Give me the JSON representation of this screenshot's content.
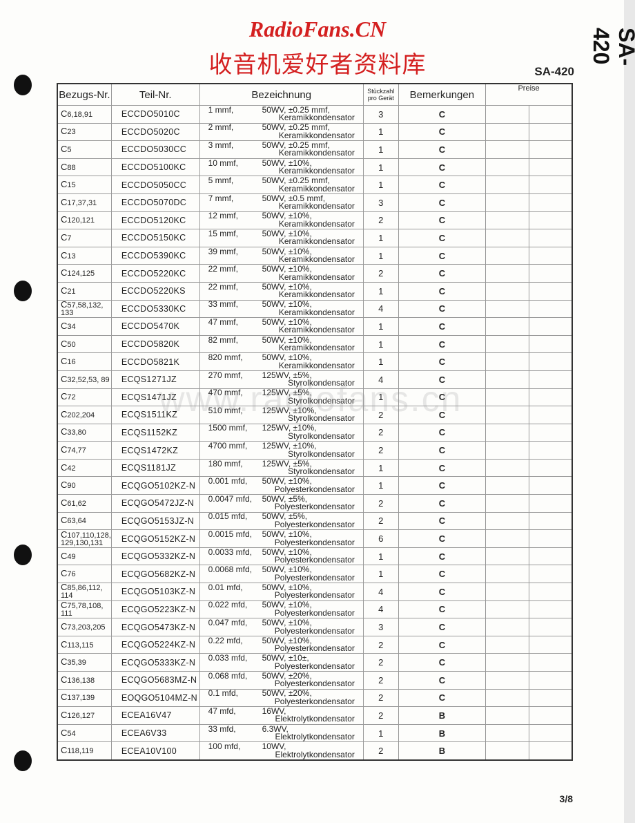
{
  "watermark": {
    "site": "RadioFans.CN",
    "chinese": "收音机爱好者资料库",
    "url": "www.radiofans.cn"
  },
  "model": "SA-420",
  "side_label": "SA-420",
  "page_number": "3/8",
  "headers": {
    "ref": "Bezugs-Nr.",
    "part": "Teil-Nr.",
    "desc": "Bezeichnung",
    "qty_line1": "Stückzahl",
    "qty_line2": "pro Gerät",
    "remarks": "Bemerkungen",
    "prices": "Preise"
  },
  "rows": [
    {
      "ref": "C",
      "sub": "6,18,91",
      "part": "ECCDO5010C",
      "value": "1 mmf,",
      "spec": "50WV, ±0.25 mmf,",
      "type": "Keramikkondensator",
      "qty": "3",
      "remark": "C"
    },
    {
      "ref": "C",
      "sub": "23",
      "part": "ECCDO5020C",
      "value": "2 mmf,",
      "spec": "50WV, ±0.25 mmf,",
      "type": "Keramikkondensator",
      "qty": "1",
      "remark": "C"
    },
    {
      "ref": "C",
      "sub": "5",
      "part": "ECCDO5030CC",
      "value": "3 mmf,",
      "spec": "50WV, ±0.25 mmf,",
      "type": "Keramikkondensator",
      "qty": "1",
      "remark": "C"
    },
    {
      "ref": "C",
      "sub": "88",
      "part": "ECCDO5100KC",
      "value": "10 mmf,",
      "spec": "50WV, ±10%,",
      "type": "Keramikkondensator",
      "qty": "1",
      "remark": "C"
    },
    {
      "ref": "C",
      "sub": "15",
      "part": "ECCDO5050CC",
      "value": "5 mmf,",
      "spec": "50WV, ±0.25 mmf,",
      "type": "Keramikkondensator",
      "qty": "1",
      "remark": "C"
    },
    {
      "ref": "C",
      "sub": "17,37,31",
      "part": "ECCDO5070DC",
      "value": "7 mmf,",
      "spec": "50WV, ±0.5 mmf,",
      "type": "Keramikkondensator",
      "qty": "3",
      "remark": "C"
    },
    {
      "ref": "C",
      "sub": "120,121",
      "part": "ECCDO5120KC",
      "value": "12 mmf,",
      "spec": "50WV, ±10%,",
      "type": "Keramikkondensator",
      "qty": "2",
      "remark": "C"
    },
    {
      "ref": "C",
      "sub": "7",
      "part": "ECCDO5150KC",
      "value": "15 mmf,",
      "spec": "50WV, ±10%,",
      "type": "Keramikkondensator",
      "qty": "1",
      "remark": "C"
    },
    {
      "ref": "C",
      "sub": "13",
      "part": "ECCDO5390KC",
      "value": "39 mmf,",
      "spec": "50WV, ±10%,",
      "type": "Keramikkondensator",
      "qty": "1",
      "remark": "C"
    },
    {
      "ref": "C",
      "sub": "124,125",
      "part": "ECCDO5220KC",
      "value": "22 mmf,",
      "spec": "50WV, ±10%,",
      "type": "Keramikkondensator",
      "qty": "2",
      "remark": "C"
    },
    {
      "ref": "C",
      "sub": "21",
      "part": "ECCDO5220KS",
      "value": "22 mmf,",
      "spec": "50WV, ±10%,",
      "type": "Keramikkondensator",
      "qty": "1",
      "remark": "C"
    },
    {
      "ref": "C",
      "sub": "57,58,132, 133",
      "part": "ECCDO5330KC",
      "value": "33 mmf,",
      "spec": "50WV, ±10%,",
      "type": "Keramikkondensator",
      "qty": "4",
      "remark": "C"
    },
    {
      "ref": "C",
      "sub": "34",
      "part": "ECCDO5470K",
      "value": "47 mmf,",
      "spec": "50WV, ±10%,",
      "type": "Keramikkondensator",
      "qty": "1",
      "remark": "C"
    },
    {
      "ref": "C",
      "sub": "50",
      "part": "ECCDO5820K",
      "value": "82 mmf,",
      "spec": "50WV, ±10%,",
      "type": "Keramikkondensator",
      "qty": "1",
      "remark": "C"
    },
    {
      "ref": "C",
      "sub": "16",
      "part": "ECCDO5821K",
      "value": "820 mmf,",
      "spec": "50WV, ±10%,",
      "type": "Keramikkondensator",
      "qty": "1",
      "remark": "C"
    },
    {
      "ref": "C",
      "sub": "32,52,53, 89",
      "part": "ECQS1271JZ",
      "value": "270 mmf,",
      "spec": "125WV, ±5%,",
      "type": "Styrolkondensator",
      "qty": "4",
      "remark": "C"
    },
    {
      "ref": "C",
      "sub": "72",
      "part": "ECQS1471JZ",
      "value": "470 mmf,",
      "spec": "125WV, ±5%,",
      "type": "Styrolkondensator",
      "qty": "1",
      "remark": "C"
    },
    {
      "ref": "C",
      "sub": "202,204",
      "part": "ECQS1511KZ",
      "value": "510 mmf,",
      "spec": "125WV, ±10%,",
      "type": "Styrolkondensator",
      "qty": "2",
      "remark": "C"
    },
    {
      "ref": "C",
      "sub": "33,80",
      "part": "ECQS1152KZ",
      "value": "1500 mmf,",
      "spec": "125WV, ±10%,",
      "type": "Styrolkondensator",
      "qty": "2",
      "remark": "C"
    },
    {
      "ref": "C",
      "sub": "74,77",
      "part": "ECQS1472KZ",
      "value": "4700 mmf,",
      "spec": "125WV, ±10%,",
      "type": "Styrolkondensator",
      "qty": "2",
      "remark": "C"
    },
    {
      "ref": "C",
      "sub": "42",
      "part": "ECQS1181JZ",
      "value": "180 mmf,",
      "spec": "125WV, ±5%,",
      "type": "Styrolkondensator",
      "qty": "1",
      "remark": "C"
    },
    {
      "ref": "C",
      "sub": "90",
      "part": "ECQGO5102KZ-N",
      "value": "0.001 mfd,",
      "spec": "50WV, ±10%,",
      "type": "Polyesterkondensator",
      "qty": "1",
      "remark": "C"
    },
    {
      "ref": "C",
      "sub": "61,62",
      "part": "ECQGO5472JZ-N",
      "value": "0.0047 mfd,",
      "spec": "50WV, ±5%,",
      "type": "Polyesterkondensator",
      "qty": "2",
      "remark": "C"
    },
    {
      "ref": "C",
      "sub": "63,64",
      "part": "ECQGO5153JZ-N",
      "value": "0.015 mfd,",
      "spec": "50WV, ±5%,",
      "type": "Polyesterkondensator",
      "qty": "2",
      "remark": "C"
    },
    {
      "ref": "C",
      "sub": "107,110,128, 129,130,131",
      "part": "ECQGO5152KZ-N",
      "value": "0.0015 mfd,",
      "spec": "50WV, ±10%,",
      "type": "Polyesterkondensator",
      "qty": "6",
      "remark": "C"
    },
    {
      "ref": "C",
      "sub": "49",
      "part": "ECQGO5332KZ-N",
      "value": "0.0033 mfd,",
      "spec": "50WV, ±10%,",
      "type": "Polyesterkondensator",
      "qty": "1",
      "remark": "C"
    },
    {
      "ref": "C",
      "sub": "76",
      "part": "ECQGO5682KZ-N",
      "value": "0.0068 mfd,",
      "spec": "50WV, ±10%,",
      "type": "Polyesterkondensator",
      "qty": "1",
      "remark": "C"
    },
    {
      "ref": "C",
      "sub": "85,86,112, 114",
      "part": "ECQGO5103KZ-N",
      "value": "0.01 mfd,",
      "spec": "50WV, ±10%,",
      "type": "Polyesterkondensator",
      "qty": "4",
      "remark": "C"
    },
    {
      "ref": "C",
      "sub": "75,78,108, 111",
      "part": "ECQGO5223KZ-N",
      "value": "0.022 mfd,",
      "spec": "50WV, ±10%,",
      "type": "Polyesterkondensator",
      "qty": "4",
      "remark": "C"
    },
    {
      "ref": "C",
      "sub": "73,203,205",
      "part": "ECQGO5473KZ-N",
      "value": "0.047 mfd,",
      "spec": "50WV, ±10%,",
      "type": "Polyesterkondensator",
      "qty": "3",
      "remark": "C"
    },
    {
      "ref": "C",
      "sub": "113,115",
      "part": "ECQGO5224KZ-N",
      "value": "0.22 mfd,",
      "spec": "50WV, ±10%,",
      "type": "Polyesterkondensator",
      "qty": "2",
      "remark": "C"
    },
    {
      "ref": "C",
      "sub": "35,39",
      "part": "ECQGO5333KZ-N",
      "value": "0.033 mfd,",
      "spec": "50WV, ±10±,",
      "type": "Polyesterkondensator",
      "qty": "2",
      "remark": "C"
    },
    {
      "ref": "C",
      "sub": "136,138",
      "part": "ECQGO5683MZ-N",
      "value": "0.068 mfd,",
      "spec": "50WV, ±20%,",
      "type": "Polyesterkondensator",
      "qty": "2",
      "remark": "C"
    },
    {
      "ref": "C",
      "sub": "137,139",
      "part": "EOQGO5104MZ-N",
      "value": "0.1 mfd,",
      "spec": "50WV, ±20%,",
      "type": "Polyesterkondensator",
      "qty": "2",
      "remark": "C"
    },
    {
      "ref": "C",
      "sub": "126,127",
      "part": "ECEA16V47",
      "value": "47 mfd,",
      "spec": "16WV,",
      "type": "Elektrolytkondensator",
      "qty": "2",
      "remark": "B"
    },
    {
      "ref": "C",
      "sub": "54",
      "part": "ECEA6V33",
      "value": "33 mfd,",
      "spec": "6.3WV,",
      "type": "Elektrolytkondensator",
      "qty": "1",
      "remark": "B"
    },
    {
      "ref": "C",
      "sub": "118,119",
      "part": "ECEA10V100",
      "value": "100 mfd,",
      "spec": "10WV,",
      "type": "Elektrolytkondensator",
      "qty": "2",
      "remark": "B"
    }
  ]
}
